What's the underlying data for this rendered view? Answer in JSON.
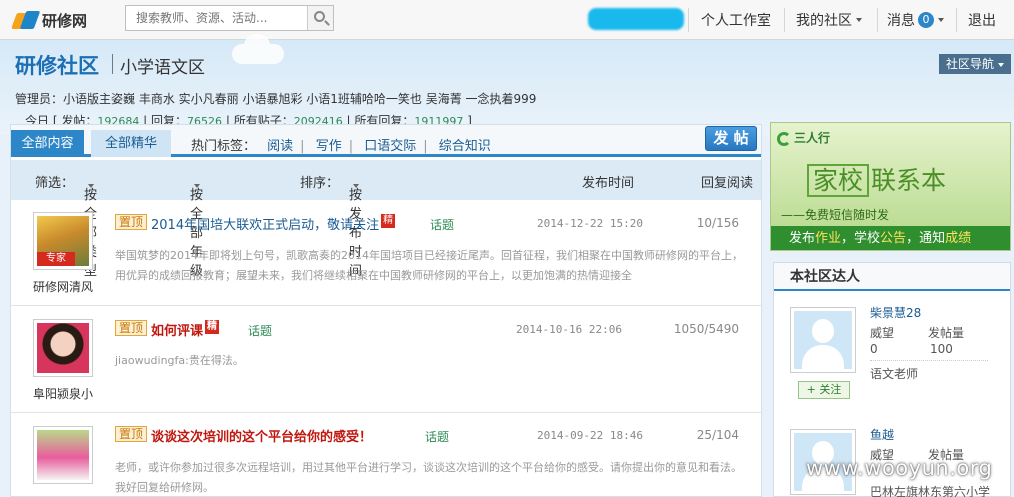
{
  "topbar": {
    "logo": "研修网",
    "search_placeholder": "搜索教师、资源、活动...",
    "nav": {
      "studio": "个人工作室",
      "my_community": "我的社区",
      "messages": "消息",
      "message_count": "0",
      "logout": "退出"
    }
  },
  "header": {
    "title": "研修社区",
    "subtitle": "小学语文区",
    "nav_button": "社区导航",
    "admins": "管理员：小语版主姿巍  丰商水  实小凡春丽  小语暴旭彩  小语1班辅哈哈一笑也  吴海菁  一念执着999",
    "stats": {
      "today_label": "今日",
      "posts_label": "发帖：",
      "posts": "192684",
      "replies_label": "回复：",
      "replies": "76526",
      "all_posts_label": "所有贴子：",
      "all_posts": "2092416",
      "all_replies_label": "所有回复：",
      "all_replies": "1911997"
    }
  },
  "tabs": {
    "all": "全部内容",
    "featured": "全部精华"
  },
  "hot_tags": {
    "label": "热门标签：",
    "items": [
      "阅读",
      "写作",
      "口语交际",
      "综合知识"
    ]
  },
  "post_button": "发 帖",
  "filter": {
    "label": "筛选：",
    "type": "按全部类型",
    "grade": "按全部年级",
    "sort_label": "排序：",
    "sort": "按发布时间",
    "col_time": "发布时间",
    "col_reply": "回复阅读"
  },
  "posts": [
    {
      "author": "研修网清风",
      "badge": "专家",
      "pin": "置顶",
      "title": "2014年国培大联欢正式启动，敬请关注",
      "jing": "精",
      "topic": "话题",
      "date": "2014-12-22 15:20",
      "counts": "10/156",
      "desc": "举国筑梦的2014年即将划上句号，凯歌高奏的2014年国培项目已经接近尾声。回首征程，我们相聚在中国教师研修网的平台上，用优异的成绩回报教育；展望未来，我们将继续相聚在中国教师研修网的平台上，以更加饱满的热情迎接全"
    },
    {
      "author": "阜阳颍泉小",
      "pin": "置顶",
      "title": "如何评课",
      "jing": "精",
      "topic": "话题",
      "date": "2014-10-16 22:06",
      "counts": "1050/5490",
      "desc": "jiaowudingfa:贵在得法。"
    },
    {
      "author": "",
      "pin": "置顶",
      "title": "谈谈这次培训的这个平台给你的感受！",
      "topic": "话题",
      "date": "2014-09-22 18:46",
      "counts": "25/104",
      "desc": "老师，或许你参加过很多次远程培训，用过其他平台进行学习，谈谈这次培训的这个平台给你的感受。请你提出你的意见和看法。我好回复给研修网。"
    }
  ],
  "ad": {
    "brand": "三人行",
    "big1": "家校",
    "big2": "联系本",
    "mid": "——免费短信随时发",
    "bottom1": "发布",
    "w1": "作业",
    "bottom2": "，学校",
    "w2": "公告",
    "bottom3": "，通知",
    "w3": "成绩"
  },
  "side": {
    "title": "本社区达人",
    "members": [
      {
        "name": "柴景慧28",
        "wang_label": "威望",
        "wang": "0",
        "posts_label": "发帖量",
        "posts": "100",
        "follow": "+ 关注",
        "role": "语文老师"
      },
      {
        "name": "鱼越",
        "wang_label": "威望",
        "posts_label": "发帖量",
        "role": "巴林左旗林东第六小学"
      }
    ]
  },
  "watermark": "www.wooyun.org"
}
